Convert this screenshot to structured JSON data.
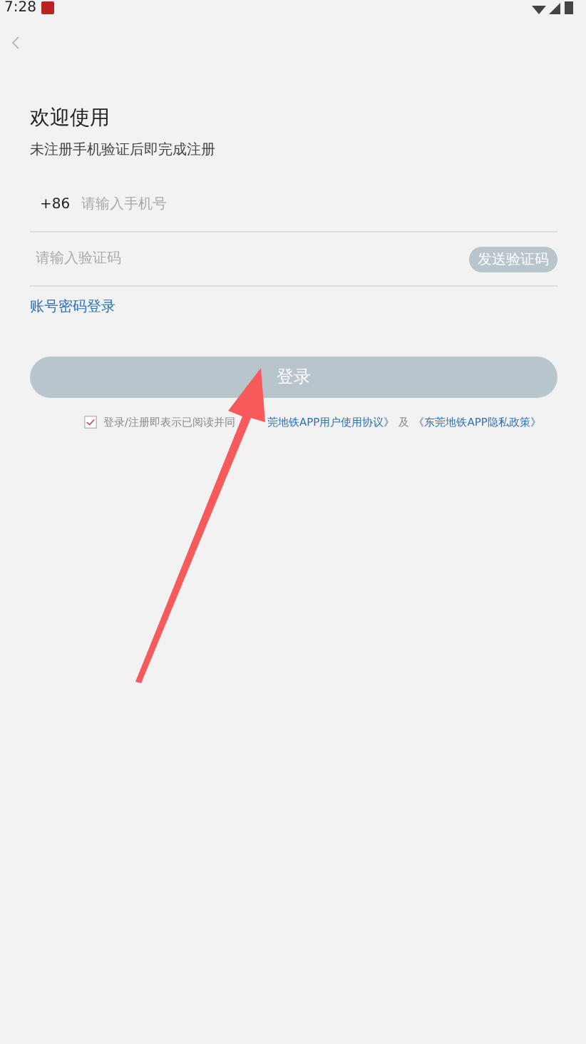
{
  "status_bar": {
    "time": "7:28"
  },
  "header": {
    "title": "欢迎使用",
    "subtitle": "未注册手机验证后即完成注册"
  },
  "phone": {
    "prefix": "+86",
    "placeholder": "请输入手机号"
  },
  "code": {
    "placeholder": "请输入验证码",
    "send_button": "发送验证码"
  },
  "password_login_link": "账号密码登录",
  "login_button": {
    "label": "登录",
    "disabled": true
  },
  "agreement": {
    "checked": true,
    "prefix": "登录/注册即表示已阅读并同",
    "link_1": "莞地铁APP用户使用协议》",
    "joiner": "及",
    "link_2": "《东莞地铁APP隐私政策》"
  }
}
